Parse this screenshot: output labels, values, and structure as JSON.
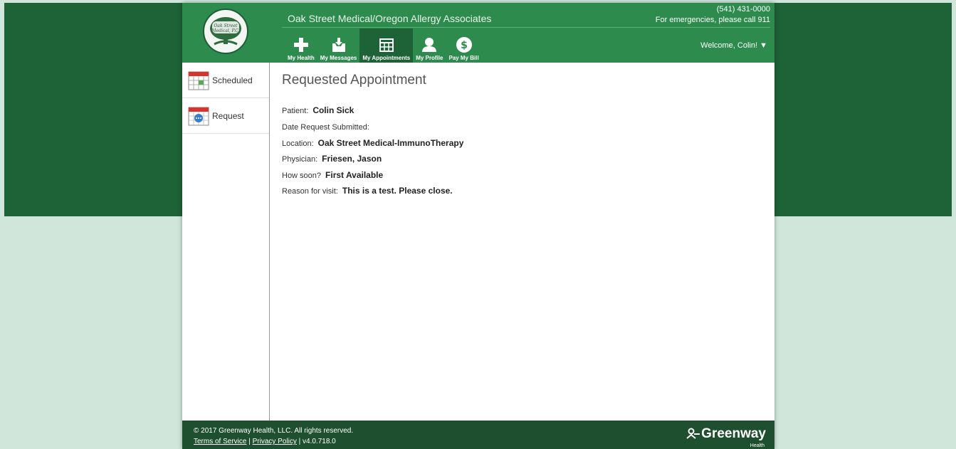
{
  "practice_name": "Oak Street Medical/Oregon Allergy Associates",
  "logo_text_1": "Oak Street",
  "logo_text_2": "Medical, P.C.",
  "phone": "(541) 431-0000",
  "emergency_note": "For emergencies, please call 911",
  "welcome": "Welcome, Colin!",
  "nav": [
    {
      "label": "My Health",
      "icon": "plus-icon"
    },
    {
      "label": "My Messages",
      "icon": "inbox-icon"
    },
    {
      "label": "My Appointments",
      "icon": "calendar-grid-icon"
    },
    {
      "label": "My Profile",
      "icon": "person-icon"
    },
    {
      "label": "Pay My Bill",
      "icon": "dollar-icon"
    }
  ],
  "sidebar": [
    {
      "label": "Scheduled",
      "icon": "calendar-icon"
    },
    {
      "label": "Request",
      "icon": "calendar-request-icon"
    }
  ],
  "page_title": "Requested Appointment",
  "fields": {
    "patient": {
      "label": "Patient:",
      "value": "Colin Sick"
    },
    "date_submitted": {
      "label": "Date Request Submitted:",
      "value": ""
    },
    "location": {
      "label": "Location:",
      "value": "Oak Street Medical-ImmunoTherapy"
    },
    "physician": {
      "label": "Physician:",
      "value": "Friesen, Jason"
    },
    "how_soon": {
      "label": "How soon?",
      "value": "First Available"
    },
    "reason": {
      "label": "Reason for visit:",
      "value": "This is a test. Please close."
    }
  },
  "footer": {
    "copyright": "© 2017 Greenway Health, LLC. All rights reserved.",
    "terms": "Terms of Service",
    "privacy": "Privacy Policy",
    "version": "| v4.0.718.0",
    "brand": "Greenway",
    "brand_sub": "Health"
  },
  "colors": {
    "header_green": "#2e8b4e",
    "dark_green": "#1e6238",
    "footer_green": "#1e4f2f",
    "light_bg": "#d0e6da"
  }
}
